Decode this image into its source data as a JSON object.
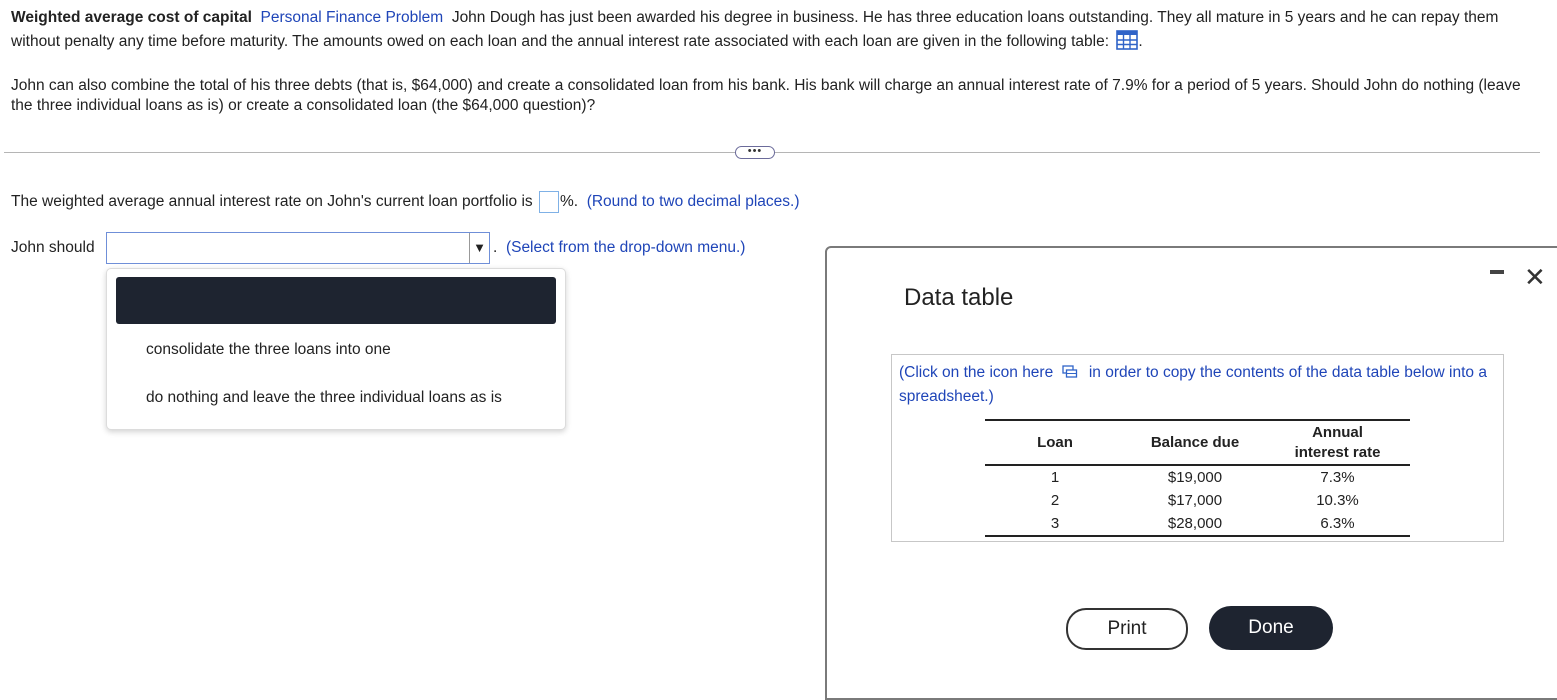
{
  "question": {
    "title": "Weighted average cost of capital",
    "category": "Personal Finance Problem",
    "text_part1": "John Dough has just been awarded his degree in business.  He has three education loans outstanding.  They all mature in 5 years and he can repay them without penalty any time before maturity.  The amounts owed on each loan and the annual interest rate associated with each loan are given in the following table:",
    "paragraph2": "John can also combine the total of his three debts (that is, $64,000) and create a consolidated loan from his bank.  His bank will charge an annual interest rate of 7.9% for a period of 5 years.  Should John do nothing (leave the three individual loans as is) or create a consolidated loan (the $64,000 question)?"
  },
  "more_button": "•••",
  "answer1": {
    "prefix": "The weighted average annual interest rate on John's current loan portfolio is",
    "suffix": "%.",
    "hint": "(Round to two decimal places.)"
  },
  "answer2": {
    "prefix": "John should",
    "selected": "",
    "suffix": ".",
    "hint": "(Select from the drop-down menu.)"
  },
  "dropdown": {
    "options": [
      "consolidate the three loans into one",
      "do nothing and leave the three individual loans as is"
    ]
  },
  "modal": {
    "title": "Data table",
    "copy_text_before": "(Click on the icon  here",
    "copy_text_after": "in order to copy the contents of the data table below into a spreadsheet.)",
    "table": {
      "headers": [
        "Loan",
        "Balance due",
        "Annual\ninterest rate"
      ],
      "rows": [
        [
          "1",
          "$19,000",
          "7.3%"
        ],
        [
          "2",
          "$17,000",
          "10.3%"
        ],
        [
          "3",
          "$28,000",
          "6.3%"
        ]
      ]
    },
    "print_label": "Print",
    "done_label": "Done",
    "close_label": "✕"
  }
}
